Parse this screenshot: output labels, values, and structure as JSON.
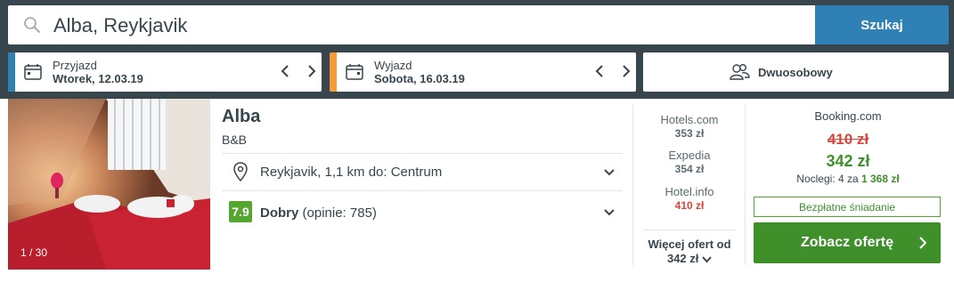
{
  "search": {
    "query": "Alba, Reykjavik",
    "button_label": "Szukaj"
  },
  "checkin": {
    "label": "Przyjazd",
    "value": "Wtorek, 12.03.19",
    "accent_color": "#2f80b5"
  },
  "checkout": {
    "label": "Wyjazd",
    "value": "Sobota, 16.03.19",
    "accent_color": "#f39a3b"
  },
  "room": {
    "label": "Dwuosobowy"
  },
  "hotel": {
    "image_counter": "1 / 30",
    "name": "Alba",
    "type": "B&B",
    "location": "Reykjavik, 1,1 km do: Centrum",
    "rating_score": "7.9",
    "rating_label": "Dobry",
    "rating_reviews": "(opinie: 785)"
  },
  "other_deals": [
    {
      "site": "Hotels.com",
      "price": "353 zł",
      "highlight": false
    },
    {
      "site": "Expedia",
      "price": "354 zł",
      "highlight": false
    },
    {
      "site": "Hotel.info",
      "price": "410 zł",
      "highlight": true
    }
  ],
  "more_offers": {
    "line1": "Więcej ofert od",
    "line2": "342 zł"
  },
  "main_deal": {
    "site": "Booking.com",
    "old_price": "410 zł",
    "new_price": "342 zł",
    "nights_prefix": "Noclegi: 4 za ",
    "nights_total": "1 368 zł",
    "badge": "Bezpłatne śniadanie",
    "cta_label": "Zobacz ofertę"
  },
  "colors": {
    "topbar": "#37454d",
    "primary_blue": "#2f80b5",
    "green": "#3f8f2b",
    "red": "#d9453a"
  }
}
